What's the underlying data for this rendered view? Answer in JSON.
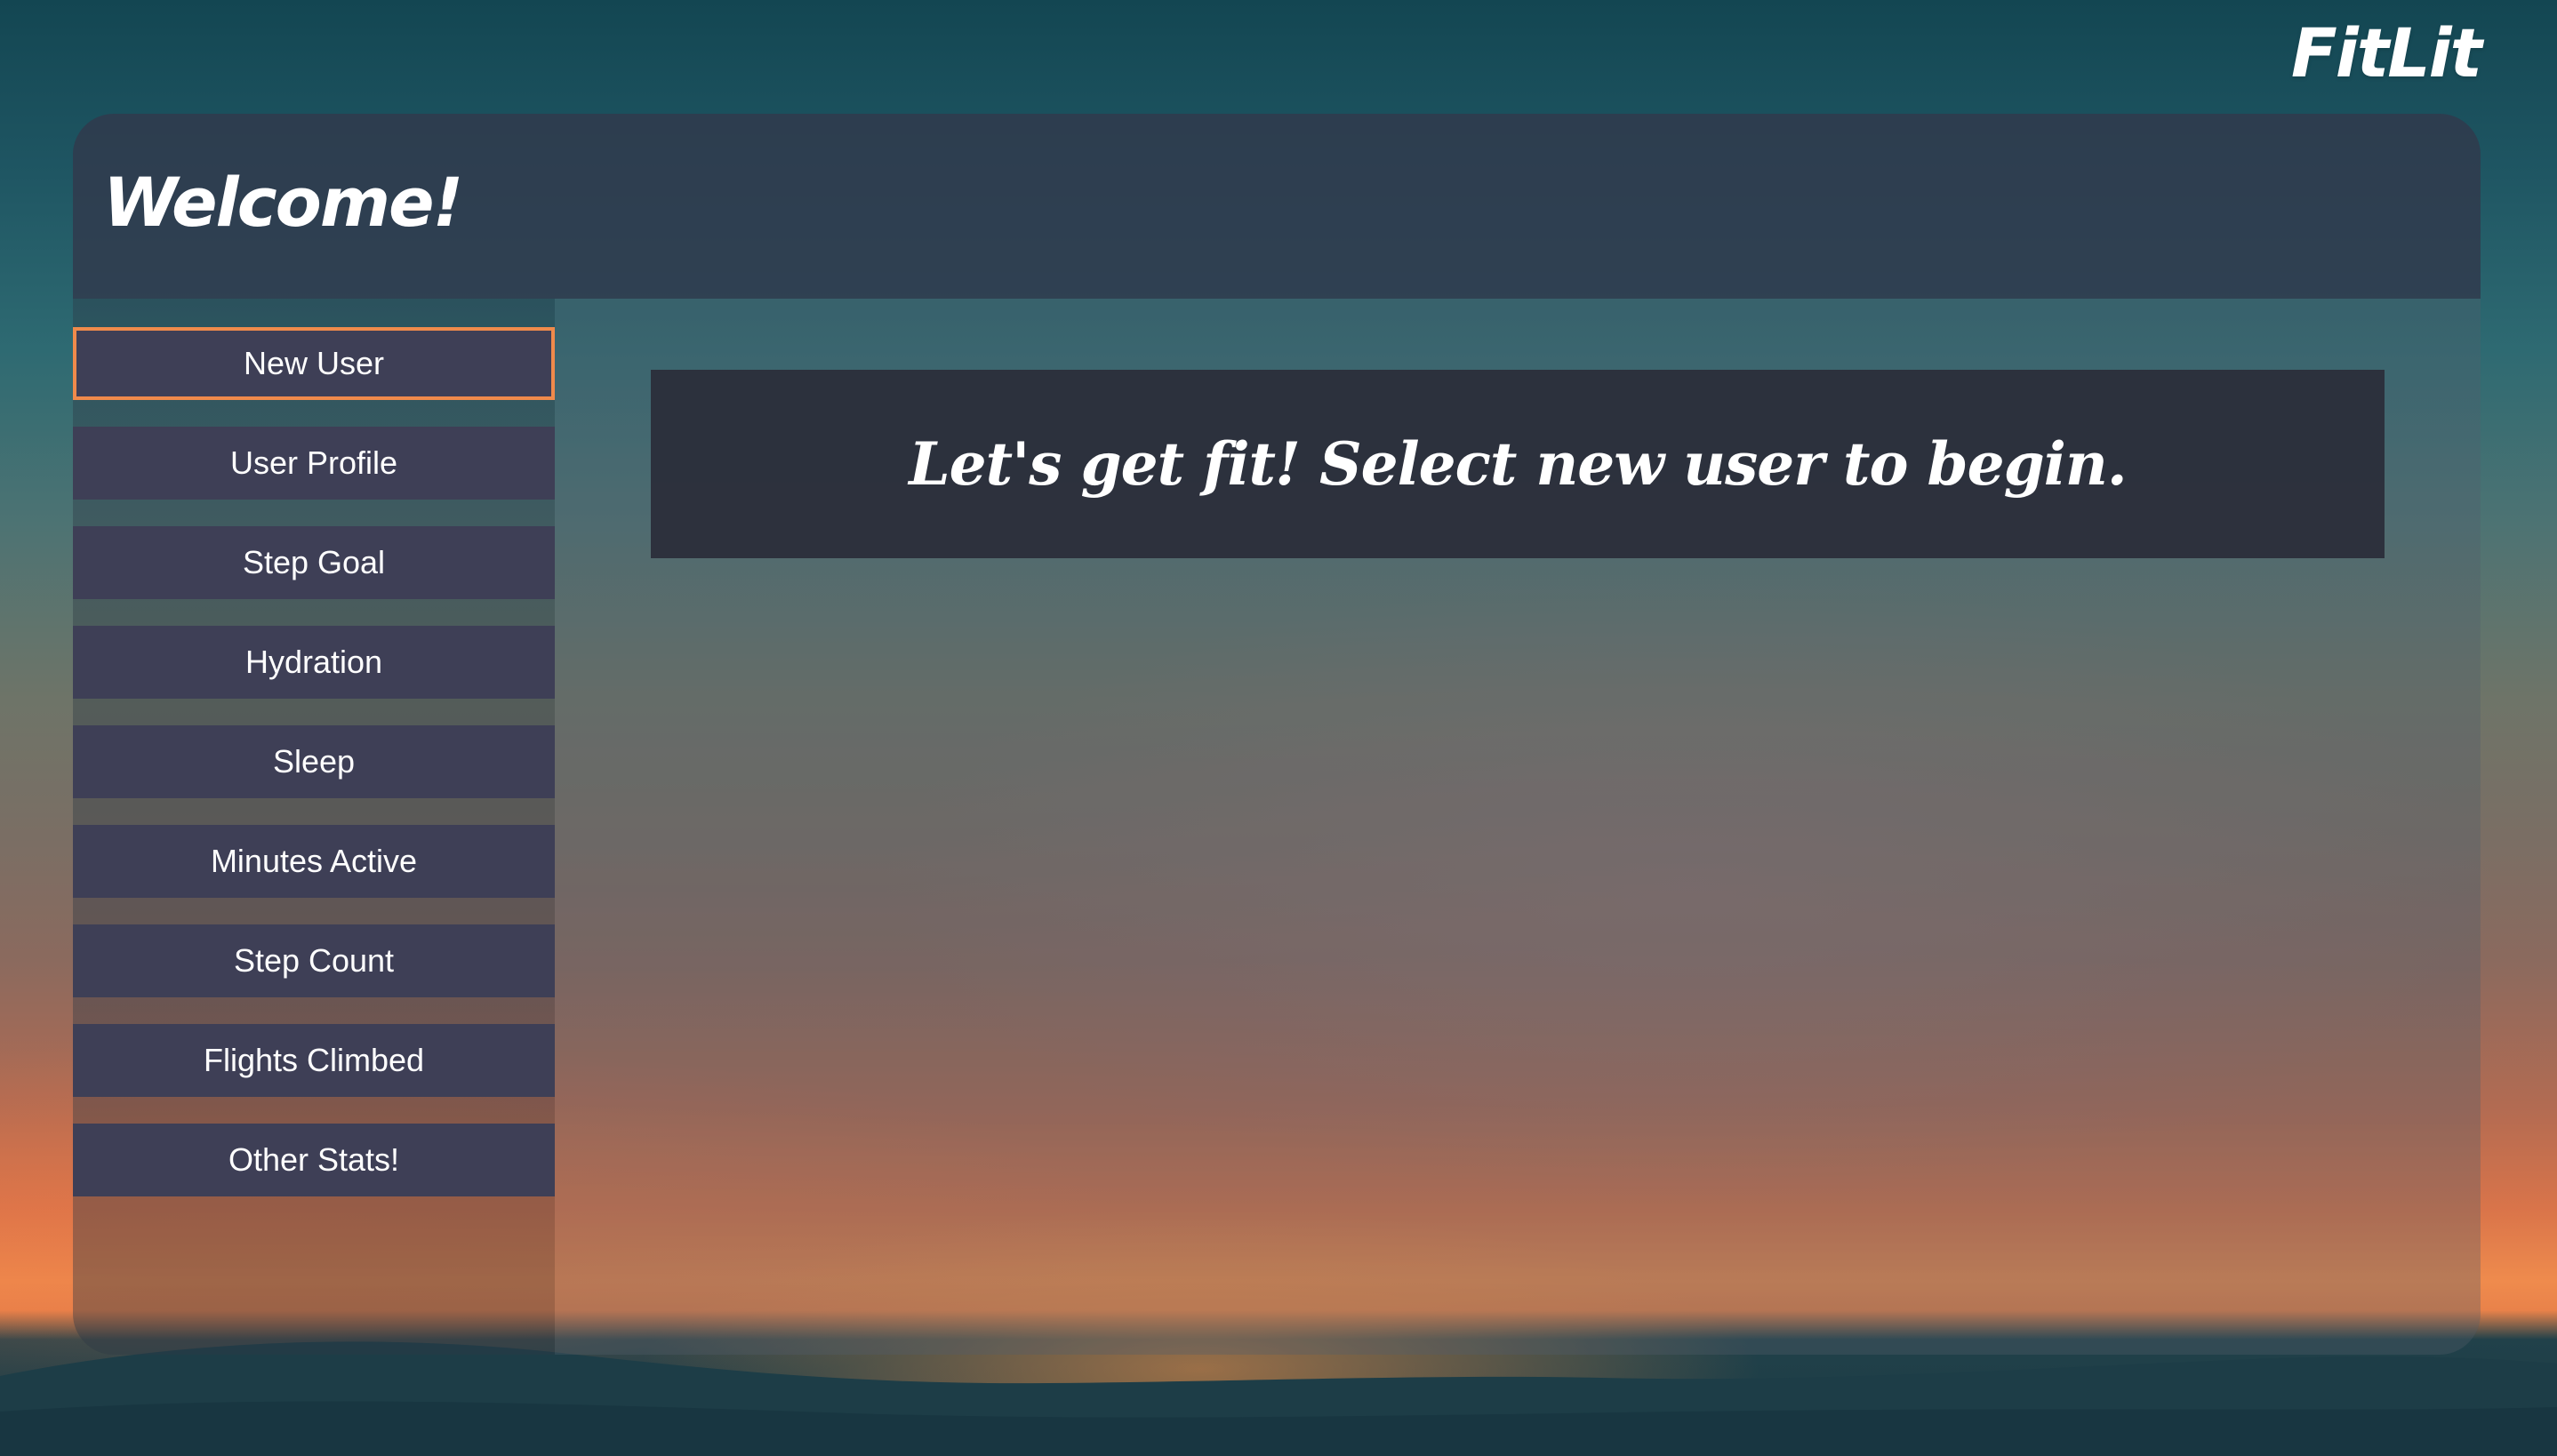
{
  "brand": {
    "name": "FitLit"
  },
  "header": {
    "title": "Welcome!"
  },
  "sidebar": {
    "items": [
      {
        "label": "New User"
      },
      {
        "label": "User Profile"
      },
      {
        "label": "Step Goal"
      },
      {
        "label": "Hydration"
      },
      {
        "label": "Sleep"
      },
      {
        "label": "Minutes Active"
      },
      {
        "label": "Step Count"
      },
      {
        "label": "Flights Climbed"
      },
      {
        "label": "Other Stats!"
      }
    ],
    "active_index": 0
  },
  "main": {
    "message": "Let's get fit! Select new user to begin."
  },
  "colors": {
    "accent_border": "#f08a4b",
    "button_bg": "#3e3f56",
    "banner_bg": "#2a2c38",
    "text": "#ffffff"
  }
}
